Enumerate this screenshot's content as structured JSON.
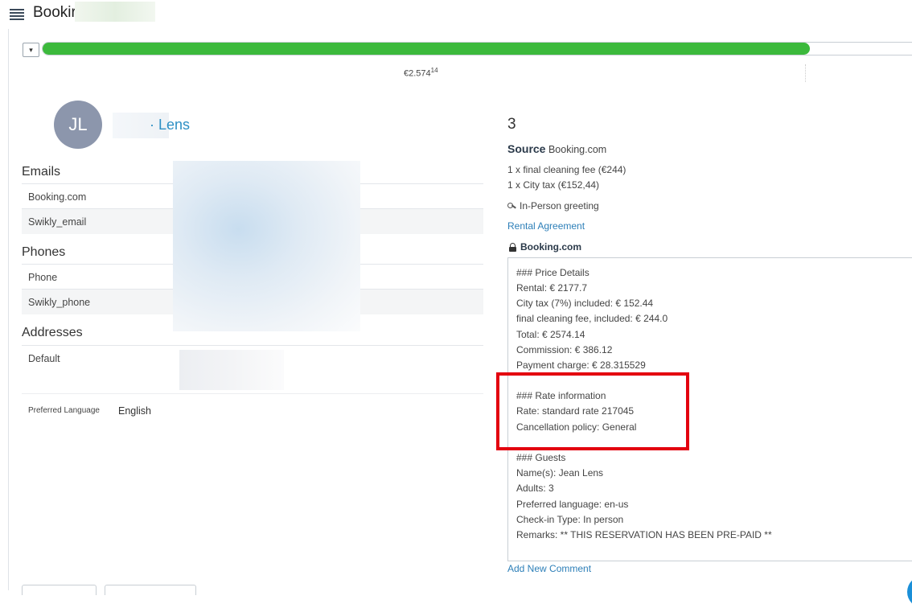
{
  "header": {
    "title": "Bookir",
    "menu_icon": "list-icon"
  },
  "progress": {
    "toggle_glyph": "▾",
    "fraction": 0.867,
    "amount_main": "€2.574",
    "amount_cents": "14",
    "color": "#3cb93c"
  },
  "guest": {
    "initials": "JL",
    "name": "· Lens"
  },
  "emails": {
    "title": "Emails",
    "rows": [
      "Booking.com",
      "Swikly_email"
    ]
  },
  "phones": {
    "title": "Phones",
    "rows": [
      "Phone",
      "Swikly_phone"
    ]
  },
  "addresses": {
    "title": "Addresses",
    "rows": [
      "Default"
    ]
  },
  "preferred_language": {
    "label": "Preferred Language",
    "value": "English"
  },
  "booking": {
    "guest_count": "3",
    "source_label": "Source",
    "source_value": "Booking.com",
    "fees": [
      "1 x final cleaning fee (€244)",
      "1 x City tax (€152,44)"
    ],
    "greeting": "In-Person greeting",
    "rental_agreement": "Rental Agreement",
    "channel": "Booking.com",
    "notes": [
      "### Price Details",
      "Rental: € 2177.7",
      "City tax (7%) included: € 152.44",
      "final cleaning fee, included: € 244.0",
      "Total: € 2574.14",
      "Commission: € 386.12",
      "Payment charge: € 28.315529",
      "",
      "### Rate information",
      "Rate: standard rate 217045",
      "Cancellation policy: General",
      "",
      "### Guests",
      "Name(s): Jean Lens",
      "Adults: 3",
      "Preferred language: en-us",
      "Check-in Type: In person",
      "Remarks: ** THIS RESERVATION HAS BEEN PRE-PAID **"
    ],
    "add_comment": "Add New Comment"
  }
}
